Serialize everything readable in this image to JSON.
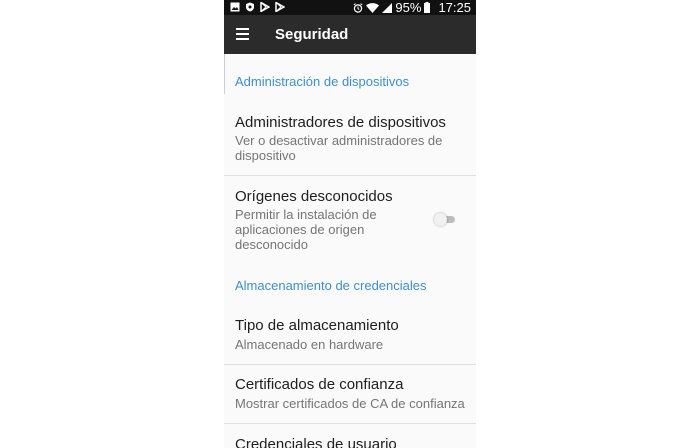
{
  "status_bar": {
    "notification_icons": [
      "image-icon",
      "shield-icon",
      "play-store-icon",
      "play-store-icon"
    ],
    "alarm_icon": "alarm-icon",
    "wifi_icon": "wifi-icon",
    "signal_icon": "signal-icon",
    "battery_text": "95%",
    "battery_icon": "battery-icon",
    "time": "17:25"
  },
  "toolbar": {
    "menu_icon": "menu-icon",
    "title": "Seguridad"
  },
  "sections": {
    "device_admin": {
      "header": "Administración de dispositivos",
      "items": [
        {
          "title": "Administradores de dispositivos",
          "subtitle": "Ver o desactivar administradores de dispositivo"
        },
        {
          "title": "Orígenes desconocidos",
          "subtitle": "Permitir la instalación de aplicaciones de origen desconocido",
          "toggle_on": false
        }
      ]
    },
    "credentials": {
      "header": "Almacenamiento de credenciales",
      "items": [
        {
          "title": "Tipo de almacenamiento",
          "subtitle": "Almacenado en hardware"
        },
        {
          "title": "Certificados de confianza",
          "subtitle": "Mostrar certificados de CA de confianza"
        },
        {
          "title": "Credenciales de usuario"
        }
      ]
    }
  },
  "colors": {
    "accent": "#3f8fc9",
    "toolbar": "#2b2b2b",
    "status_bar": "#111111",
    "background": "#fafafa"
  }
}
